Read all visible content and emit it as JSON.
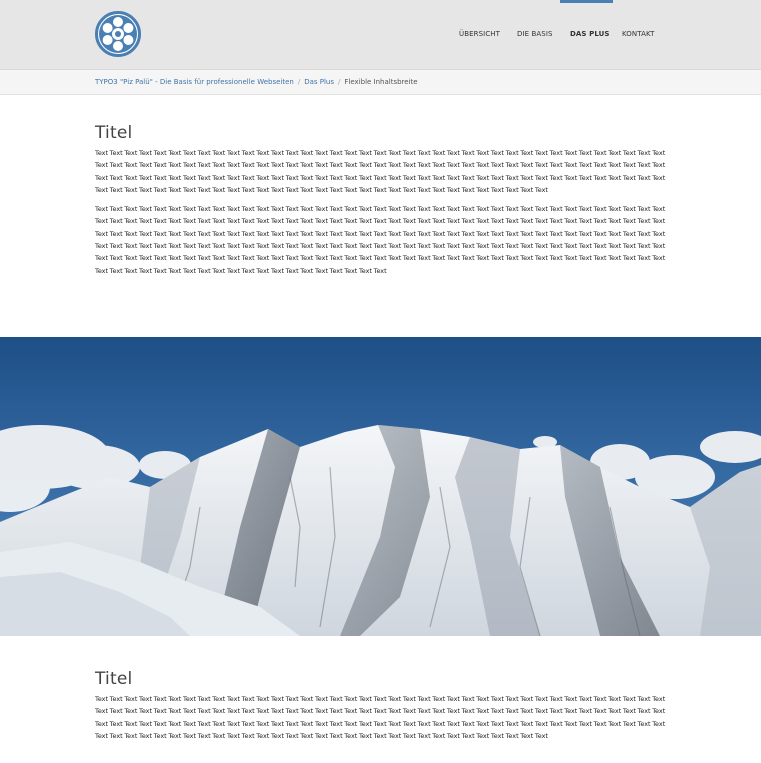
{
  "nav": {
    "items": [
      {
        "label": "ÜBERSICHT",
        "active": false
      },
      {
        "label": "DIE BASIS",
        "active": false
      },
      {
        "label": "DAS PLUS",
        "active": true
      },
      {
        "label": "KONTAKT",
        "active": false
      }
    ]
  },
  "breadcrumb": {
    "items": [
      {
        "label": "TYPO3 \"Piz Palü\" - Die Basis für professionelle Webseiten",
        "link": true
      },
      {
        "label": "Das Plus",
        "link": true
      },
      {
        "label": "Flexible Inhaltsbreite",
        "link": false
      }
    ]
  },
  "section1": {
    "title": "Titel",
    "para1": "Text Text Text Text Text Text Text Text Text Text Text Text Text Text Text Text Text Text Text Text Text Text Text Text Text Text Text Text Text Text Text Text Text Text Text Text Text Text Text Text Text Text Text Text Text Text Text Text Text Text Text Text Text Text Text Text Text Text Text Text Text Text Text Text Text Text Text Text Text Text Text Text Text Text Text Text Text Text Text Text Text Text Text Text Text Text Text Text Text Text Text Text Text Text Text Text Text Text Text Text Text Text Text Text Text Text Text Text Text Text Text Text Text Text Text Text Text Text Text Text Text Text Text Text Text Text Text Text Text Text Text Text Text Text Text Text Text Text Text Text Text Text Text Text Text Text Text Text",
    "para2": "Text Text Text Text Text Text Text Text Text Text Text Text Text Text Text Text Text Text Text Text Text Text Text Text Text Text Text Text Text Text Text Text Text Text Text Text Text Text Text Text Text Text Text Text Text Text Text Text Text Text Text Text Text Text Text Text Text Text Text Text Text Text Text Text Text Text Text Text Text Text Text Text Text Text Text Text Text Text Text Text Text Text Text Text Text Text Text Text Text Text Text Text Text Text Text Text Text Text Text Text Text Text Text Text Text Text Text Text Text Text Text Text Text Text Text Text Text Text Text Text Text Text Text Text Text Text Text Text Text Text Text Text Text Text Text Text Text Text Text Text Text Text Text Text Text Text Text Text Text Text Text Text Text Text Text Text Text Text Text Text Text Text Text Text Text Text Text Text Text Text Text Text Text Text Text Text Text Text Text Text Text Text Text Text Text Text Text Text Text Text Text Text Text Text Text Text Text Text Text Text Text Text Text Text Text Text Text Text Text Text Text Text Text Text Text"
  },
  "section2": {
    "title": "Titel",
    "para1": "Text Text Text Text Text Text Text Text Text Text Text Text Text Text Text Text Text Text Text Text Text Text Text Text Text Text Text Text Text Text Text Text Text Text Text Text Text Text Text Text Text Text Text Text Text Text Text Text Text Text Text Text Text Text Text Text Text Text Text Text Text Text Text Text Text Text Text Text Text Text Text Text Text Text Text Text Text Text Text Text Text Text Text Text Text Text Text Text Text Text Text Text Text Text Text Text Text Text Text Text Text Text Text Text Text Text Text Text Text Text Text Text Text Text Text Text Text Text Text Text Text Text Text Text Text Text Text Text Text Text Text Text Text Text Text Text Text Text Text Text Text Text Text Text Text Text Text Text"
  },
  "colors": {
    "header_bg": "#e6e6e6",
    "accent": "#4a7fb3",
    "link": "#3f75a8"
  },
  "icons": {
    "logo": "asterisk-logo"
  }
}
